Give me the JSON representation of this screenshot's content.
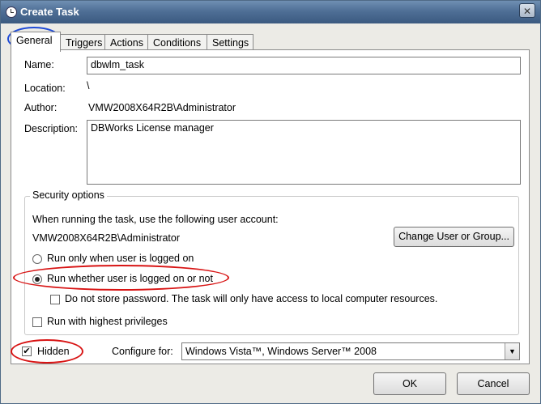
{
  "window": {
    "title": "Create Task",
    "close_label": "✕"
  },
  "tabs": [
    "General",
    "Triggers",
    "Actions",
    "Conditions",
    "Settings"
  ],
  "general": {
    "name_label": "Name:",
    "name_value": "dbwlm_task",
    "location_label": "Location:",
    "location_value": "\\",
    "author_label": "Author:",
    "author_value": "VMW2008X64R2B\\Administrator",
    "description_label": "Description:",
    "description_value": "DBWorks License manager"
  },
  "security": {
    "group_title": "Security options",
    "account_prompt": "When running the task, use the following user account:",
    "account_value": "VMW2008X64R2B\\Administrator",
    "change_button": "Change User or Group...",
    "radio_logged_on": "Run only when user is logged on",
    "radio_whether": "Run whether user is logged on or not",
    "selected_radio": "Run whether user is logged on or not",
    "store_password": "Do not store password.  The task will only have access to local computer resources.",
    "store_password_checked": false,
    "highest_privileges": "Run with highest privileges",
    "highest_privileges_checked": false
  },
  "bottom": {
    "hidden_label": "Hidden",
    "hidden_checked": true,
    "configure_label": "Configure for:",
    "configure_value": "Windows Vista™, Windows Server™ 2008",
    "ok_label": "OK",
    "cancel_label": "Cancel"
  },
  "annotation_colors": {
    "general_tab": "#1f4bd6",
    "run_whether": "#d81414",
    "hidden": "#d81414"
  }
}
